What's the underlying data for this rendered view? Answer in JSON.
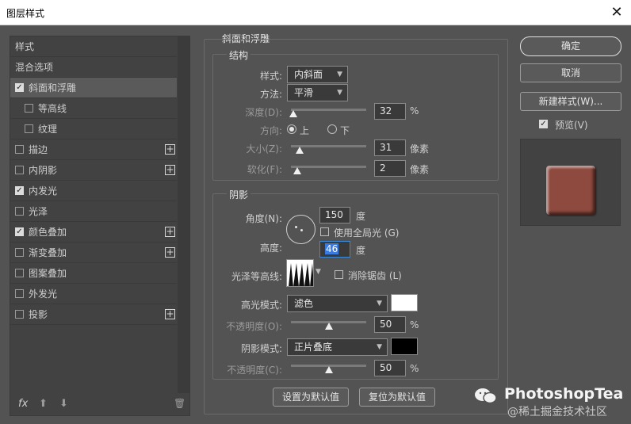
{
  "window": {
    "title": "图层样式",
    "close_glyph": "✕"
  },
  "sidebar": {
    "items": [
      {
        "label": "样式",
        "checkbox": false,
        "checked": false,
        "plus": false
      },
      {
        "label": "混合选项",
        "checkbox": false,
        "checked": false,
        "plus": false
      },
      {
        "label": "斜面和浮雕",
        "checkbox": true,
        "checked": true,
        "plus": false,
        "selected": true
      },
      {
        "label": "等高线",
        "checkbox": true,
        "checked": false,
        "plus": false,
        "indent": true
      },
      {
        "label": "纹理",
        "checkbox": true,
        "checked": false,
        "plus": false,
        "indent": true
      },
      {
        "label": "描边",
        "checkbox": true,
        "checked": false,
        "plus": true
      },
      {
        "label": "内阴影",
        "checkbox": true,
        "checked": false,
        "plus": true
      },
      {
        "label": "内发光",
        "checkbox": true,
        "checked": true,
        "plus": false
      },
      {
        "label": "光泽",
        "checkbox": true,
        "checked": false,
        "plus": false
      },
      {
        "label": "颜色叠加",
        "checkbox": true,
        "checked": true,
        "plus": true
      },
      {
        "label": "渐变叠加",
        "checkbox": true,
        "checked": false,
        "plus": true
      },
      {
        "label": "图案叠加",
        "checkbox": true,
        "checked": false,
        "plus": false
      },
      {
        "label": "外发光",
        "checkbox": true,
        "checked": false,
        "plus": false
      },
      {
        "label": "投影",
        "checkbox": true,
        "checked": false,
        "plus": true
      }
    ],
    "footer": {
      "fx": "fx",
      "up": "⬆",
      "down": "⬇",
      "trash": "🗑"
    }
  },
  "bevel": {
    "section_title": "斜面和浮雕",
    "structure_title": "结构",
    "style_label": "样式:",
    "style_value": "内斜面",
    "technique_label": "方法:",
    "technique_value": "平滑",
    "depth_label": "深度(D):",
    "depth_value": "32",
    "depth_unit": "%",
    "depth_level": 0.03,
    "direction_label": "方向:",
    "dir_up": "上",
    "dir_down": "下",
    "size_label": "大小(Z):",
    "size_value": "31",
    "size_unit": "像素",
    "size_level": 0.12,
    "soften_label": "软化(F):",
    "soften_value": "2",
    "soften_unit": "像素",
    "soften_level": 0.08
  },
  "shading": {
    "title": "阴影",
    "angle_label": "角度(N):",
    "angle_value": "150",
    "angle_unit": "度",
    "global_light_label": "使用全局光 (G)",
    "altitude_label": "高度:",
    "altitude_value": "46",
    "altitude_unit": "度",
    "gloss_label": "光泽等高线:",
    "antialias_label": "消除锯齿 (L)",
    "highlight_mode_label": "高光模式:",
    "highlight_mode_value": "滤色",
    "highlight_color": "#ffffff",
    "highlight_opacity_label": "不透明度(O):",
    "highlight_opacity_value": "50",
    "highlight_opacity_unit": "%",
    "highlight_opacity_level": 0.5,
    "shadow_mode_label": "阴影模式:",
    "shadow_mode_value": "正片叠底",
    "shadow_color": "#000000",
    "shadow_opacity_label": "不透明度(C):",
    "shadow_opacity_value": "50",
    "shadow_opacity_unit": "%",
    "shadow_opacity_level": 0.5,
    "make_default": "设置为默认值",
    "reset_default": "复位为默认值"
  },
  "actions": {
    "ok": "确定",
    "cancel": "取消",
    "new_style": "新建样式(W)...",
    "preview_label": "预览(V)",
    "preview_color": "#8e4a3f"
  },
  "watermark": {
    "brand": "PhotoshopTea",
    "sub": "@稀土掘金技术社区"
  }
}
